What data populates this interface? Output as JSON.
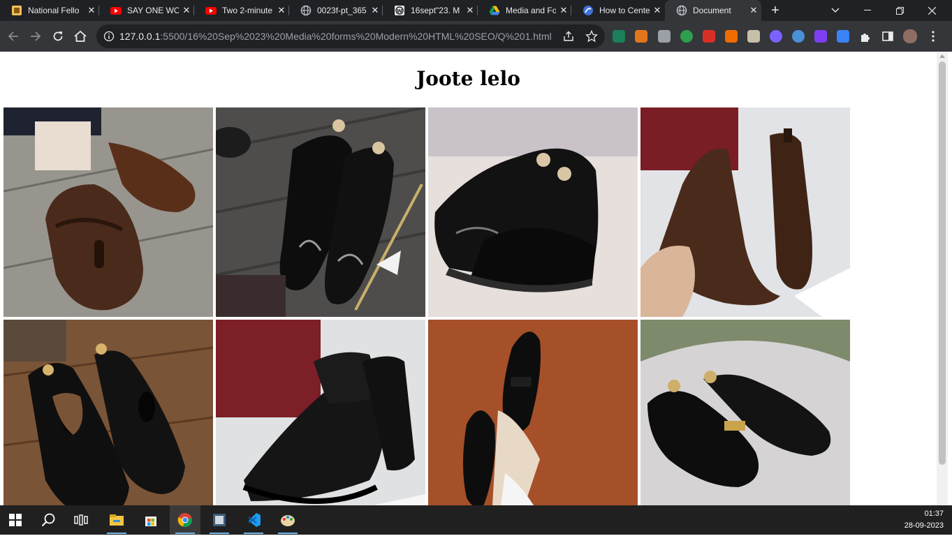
{
  "browser": {
    "tabs": [
      {
        "title": "National Fello",
        "icon": "bookmark-favicon"
      },
      {
        "title": "SAY ONE WO",
        "icon": "youtube-favicon"
      },
      {
        "title": "Two 2-minute",
        "icon": "youtube-favicon"
      },
      {
        "title": "0023f-pt_365",
        "icon": "globe-favicon"
      },
      {
        "title": "16sept\"23. M",
        "icon": "wordpress-favicon"
      },
      {
        "title": "Media and Fo",
        "icon": "drive-favicon"
      },
      {
        "title": "How to Cente",
        "icon": "edge-favicon"
      },
      {
        "title": "Document",
        "icon": "globe-favicon"
      }
    ],
    "url_host": "127.0.0.1",
    "url_path": ":5500/16%20Sep%2023%20Media%20forms%20Modern%20HTML%20SEO/Q%201.html"
  },
  "page": {
    "heading": "Joote lelo",
    "images": [
      {
        "alt": "brown wingtip tassel loafers"
      },
      {
        "alt": "black patent cap-toe oxfords with accessories"
      },
      {
        "alt": "black glitter and patent shoes"
      },
      {
        "alt": "brown croc-embossed chelsea boots"
      },
      {
        "alt": "black patent tassel loafers"
      },
      {
        "alt": "black croc-embossed chelsea boots"
      },
      {
        "alt": "black suede monk slippers"
      },
      {
        "alt": "black patent horsebit loafers on fur"
      }
    ]
  },
  "taskbar": {
    "time": "01:37",
    "date": "28-09-2023"
  },
  "colors": {
    "tab_strip": "#202124",
    "toolbar": "#35363a",
    "taskbar": "#202020"
  }
}
